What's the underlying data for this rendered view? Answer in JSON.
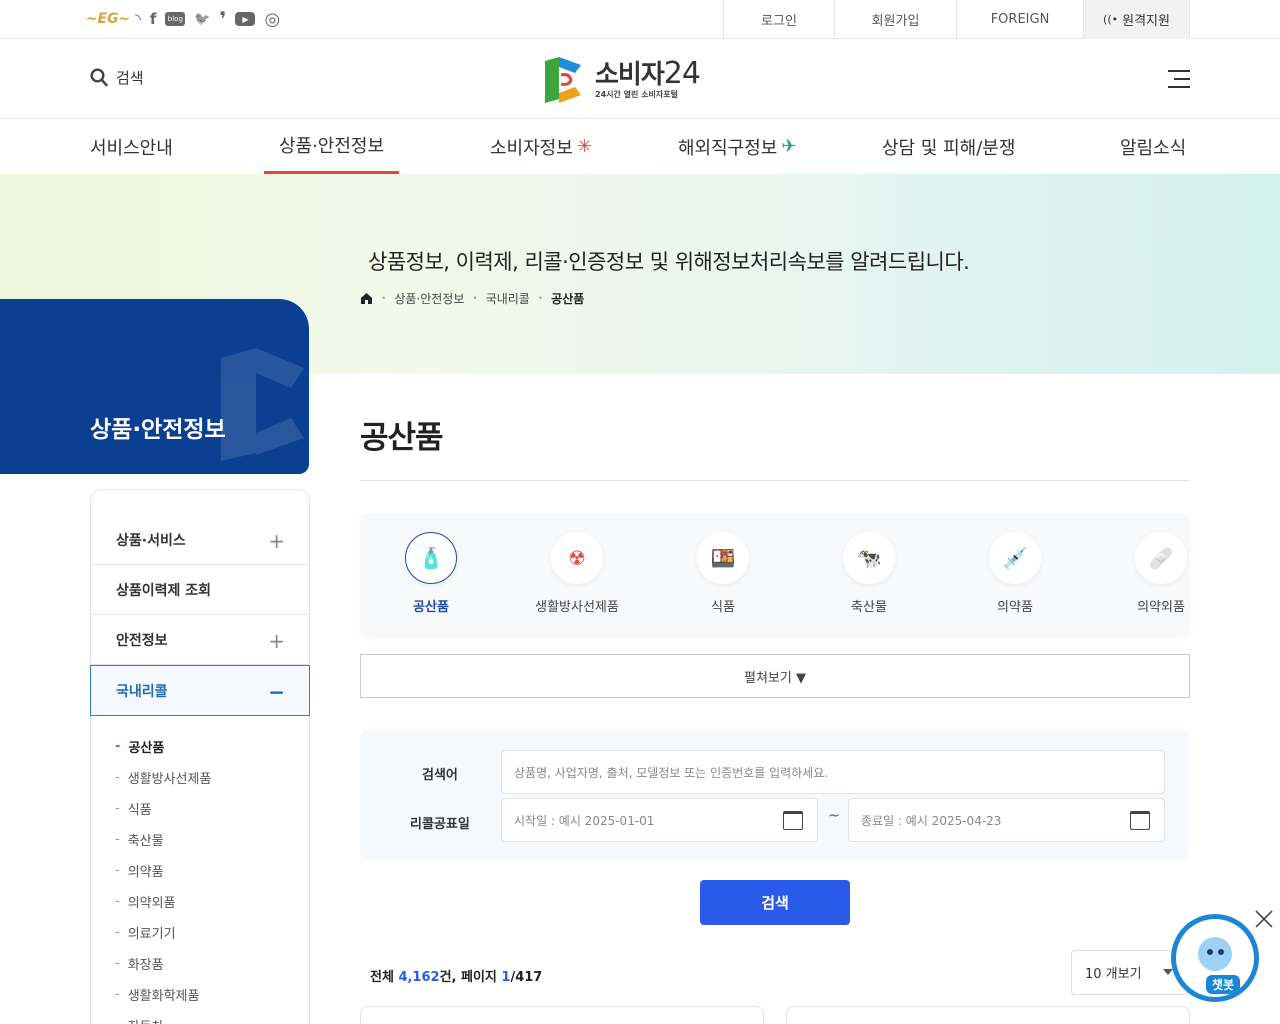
{
  "util": {
    "sns": [
      {
        "name": "eg-icon",
        "glyph": "~EG~"
      },
      {
        "name": "rss-icon",
        "glyph": "◝"
      },
      {
        "name": "facebook-icon",
        "glyph": "f"
      },
      {
        "name": "blog-icon",
        "glyph": "blog"
      },
      {
        "name": "twitter-icon",
        "glyph": "🐦"
      },
      {
        "name": "post-icon",
        "glyph": "❜"
      },
      {
        "name": "youtube-icon",
        "glyph": "▶"
      },
      {
        "name": "instagram-icon",
        "glyph": "◎"
      }
    ],
    "menu": [
      "로그인",
      "회원가입",
      "FOREIGN",
      "원격지원"
    ]
  },
  "header": {
    "search_label": "검색",
    "logo_main": "소비자",
    "logo_num": "24",
    "logo_sub": "24시간 열린 소비자포털"
  },
  "gnb": [
    "서비스안내",
    "상품·안전정보",
    "소비자정보",
    "해외직구정보",
    "상담 및 피해/분쟁",
    "알림소식"
  ],
  "hero": {
    "title": "상품정보, 이력제, 리콜·인증정보 및 위해정보처리속보를 알려드립니다.",
    "crumb": [
      "상품·안전정보",
      "국내리콜",
      "공산품"
    ]
  },
  "side": {
    "title": "상품·안전정보",
    "items": [
      {
        "label": "상품·서비스",
        "toggle": "+"
      },
      {
        "label": "상품이력제 조회",
        "toggle": ""
      },
      {
        "label": "안전정보",
        "toggle": "+"
      },
      {
        "label": "국내리콜",
        "toggle": "−"
      }
    ],
    "sub": [
      "공산품",
      "생활방사선제품",
      "식품",
      "축산물",
      "의약품",
      "의약외품",
      "의료기기",
      "화장품",
      "생활화학제품",
      "자동차"
    ]
  },
  "main": {
    "title": "공산품",
    "categories": [
      {
        "label": "공산품",
        "icon": "🧴"
      },
      {
        "label": "생활방사선제품",
        "icon": "☢"
      },
      {
        "label": "식품",
        "icon": "🍱"
      },
      {
        "label": "축산물",
        "icon": "🐄"
      },
      {
        "label": "의약품",
        "icon": "💉"
      },
      {
        "label": "의약외품",
        "icon": "🩹"
      }
    ],
    "expand_label": "펼쳐보기 ▼",
    "search": {
      "keyword_label": "검색어",
      "keyword_placeholder": "상품명, 사업자명, 출처, 모델정보 또는 인증번호를 입력하세요.",
      "date_label": "리콜공표일",
      "start_placeholder": "시작일 : 예시 2025-01-01",
      "end_placeholder": "종료일 : 예시 2025-04-23",
      "tilde": "~",
      "button": "검색"
    },
    "total": {
      "prefix": "전체 ",
      "count": "4,162",
      "mid": "건, 페이지 ",
      "page": "1",
      "pages": "/417"
    },
    "per_page": "10 개보기"
  },
  "chatbot": {
    "label": "챗봇"
  },
  "colors": {
    "accent_red": "#e4463c",
    "navy": "#0a3f91",
    "blue": "#2a5be8"
  }
}
